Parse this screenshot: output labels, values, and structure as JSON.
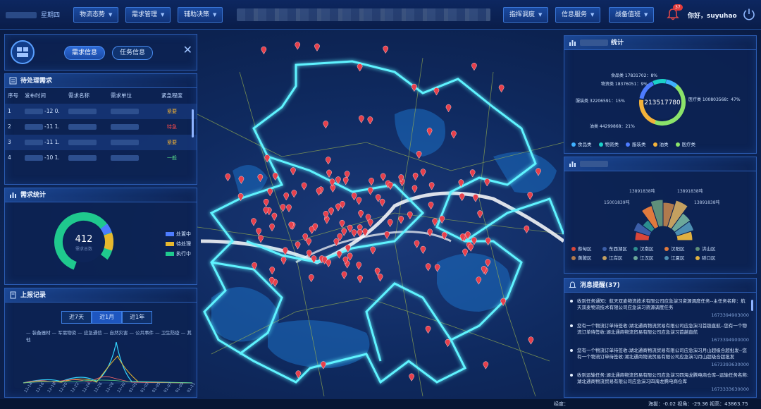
{
  "header": {
    "date": "星期四",
    "nav_left": [
      "物流态势",
      "需求管理",
      "辅助决策"
    ],
    "nav_right": [
      "指挥调度",
      "信息服务",
      "战备值班"
    ],
    "bell_count": "37",
    "greeting": "你好，suyuhao"
  },
  "left_tabs": {
    "tab1": "需求信息",
    "tab2": "任务信息",
    "close": "✕"
  },
  "pending": {
    "title": "待处理需求",
    "columns": [
      "序号",
      "发布时间",
      "需求名称",
      "需求单位",
      "紧急程度"
    ],
    "rows": [
      {
        "no": "1",
        "time": "-12 0.",
        "level": "紧要",
        "color": "#f2b233"
      },
      {
        "no": "2",
        "time": "-11 1.",
        "level": "特急",
        "color": "#ff4a4a"
      },
      {
        "no": "3",
        "time": "-11 1.",
        "level": "紧要",
        "color": "#f2b233"
      },
      {
        "no": "4",
        "time": "-10 1.",
        "level": "一般",
        "color": "#57d98a"
      }
    ]
  },
  "stats": {
    "title": "需求统计",
    "total": "412",
    "sub": "需求总数",
    "legend": [
      "处置中",
      "待处理",
      "执行中"
    ],
    "colors": [
      "#4d7cff",
      "#e8b82e",
      "#1fc98e"
    ]
  },
  "reports": {
    "title": "上报记录",
    "segs": [
      "近7天",
      "近1月",
      "近1年"
    ],
    "legend_line1": "— 装备器材  — 军需物资  — 应急通信  — 自然灾害  — 公共事件  — 卫生防疫  — 其他",
    "xticks": [
      "12-14",
      "12-16",
      "12-18",
      "12-20",
      "12-22",
      "12-24",
      "12-26",
      "12-28",
      "12-30",
      "01-01",
      "01-03",
      "01-05",
      "01-07",
      "01-09",
      "01-11"
    ]
  },
  "r1": {
    "title": "统计",
    "center": "213517780",
    "labels": [
      "食品类 17831702：8%",
      "物资类 18376051：9%",
      "服装类 32206591：15%",
      "医疗类 100803568：47%",
      "油类 44299868：21%"
    ],
    "legend": [
      "食品类",
      "物资类",
      "服装类",
      "油类",
      "医疗类"
    ],
    "colors": [
      "#3fb0ff",
      "#1bd1c9",
      "#4d7cff",
      "#f3b23a",
      "#8be36a"
    ]
  },
  "r2": {
    "labels_top": [
      "13891838吨",
      "13891838吨",
      "15001839吨",
      "13891838吨"
    ],
    "legend": [
      "蔡甸区",
      "东西湖区",
      "汉南区",
      "汉阳区",
      "洪山区",
      "黄陂区",
      "江岸区",
      "江汉区",
      "江夏区",
      "硚口区"
    ],
    "colors": [
      "#d9463a",
      "#3b5ea8",
      "#2c8e8f",
      "#e07a3d",
      "#5f8f7a",
      "#b07a4d",
      "#c4a060",
      "#6ca89a",
      "#4d8fb2",
      "#e0b040"
    ]
  },
  "r3": {
    "title": "消息提醒(37)",
    "messages": [
      {
        "text": "收到任务通知：航天双麦物流技术有限公司应急演习资源调度任务--主任务名称：航天双麦物流技术有限公司应急演习资源调度任务",
        "ts": "1673394903000"
      },
      {
        "text": "您有一个物流订单待签收:湖北通商物流贸易有限公司应急演习首趟直航--您有一个物流订单待签收:湖北通商物流贸易有限公司应急演习首趟直航",
        "ts": "1673394900000"
      },
      {
        "text": "您有一个物流订单待签收:湖北通商物流贸易有限公司应急演习月山超级合超批发--您有一个物流订单待签收:湖北通商物流贸易有限公司应急演习月山超级合超批发",
        "ts": "1673393630000"
      },
      {
        "text": "收到运输任务:湖北通商物流贸易有限公司应急演习四海龙腾电商仓库--运输任务名称:湖北通商物流贸易有限公司应急演习四海龙腾电商仓库",
        "ts": "1673333630000"
      }
    ]
  },
  "status": {
    "left": "经度：",
    "right": "海拔：-0.02 视角：-29.36 视高：43863.75"
  }
}
